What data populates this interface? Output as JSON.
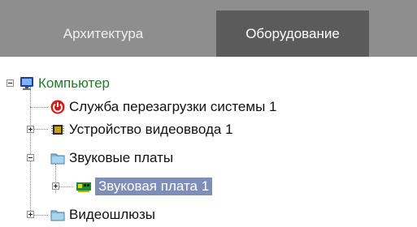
{
  "tabs": {
    "architecture": "Архитектура",
    "hardware": "Оборудование"
  },
  "tree": {
    "computer": "Компьютер",
    "restart_service": "Служба перезагрузки системы 1",
    "video_input": "Устройство видеоввода 1",
    "sound_cards": "Звуковые платы",
    "sound_card_1": "Звуковая плата 1",
    "video_gateways": "Видеошлюзы"
  },
  "colors": {
    "tab_bar": "#8e8e8e",
    "active_tab": "#5b5b5b",
    "selection": "#7d8fb8",
    "root_label": "#1e7d2a"
  },
  "icons": {
    "computer": "monitor-icon",
    "restart_service": "power-icon",
    "video_input": "chip-icon",
    "sound_cards": "folder-icon",
    "sound_card_1": "sound-card-icon",
    "video_gateways": "folder-icon"
  }
}
